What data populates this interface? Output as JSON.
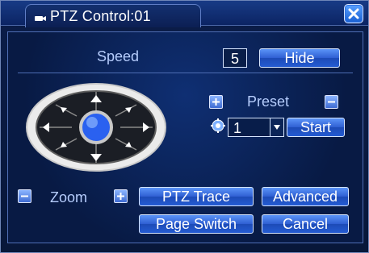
{
  "window": {
    "title": "PTZ Control:01",
    "close_icon": "close-icon"
  },
  "speed": {
    "label": "Speed",
    "value": "5"
  },
  "buttons": {
    "hide": "Hide",
    "start": "Start",
    "ptz_trace": "PTZ Trace",
    "advanced": "Advanced",
    "page_switch": "Page Switch",
    "cancel": "Cancel"
  },
  "preset": {
    "label": "Preset",
    "selected": "1",
    "options": [
      "1"
    ]
  },
  "zoom": {
    "label": "Zoom"
  },
  "icons": {
    "title_camera": "camera-icon",
    "preset_add": "plus-icon",
    "preset_remove": "minus-icon",
    "preset_gear": "gear-icon",
    "zoom_out": "minus-icon",
    "zoom_in": "plus-icon",
    "dropdown": "chevron-down-icon",
    "dpad": "direction-pad-icon"
  },
  "colors": {
    "accent_blue": "#2f5fd2",
    "text_light_blue": "#b6cdfd",
    "border_light": "#d7e6ff"
  }
}
